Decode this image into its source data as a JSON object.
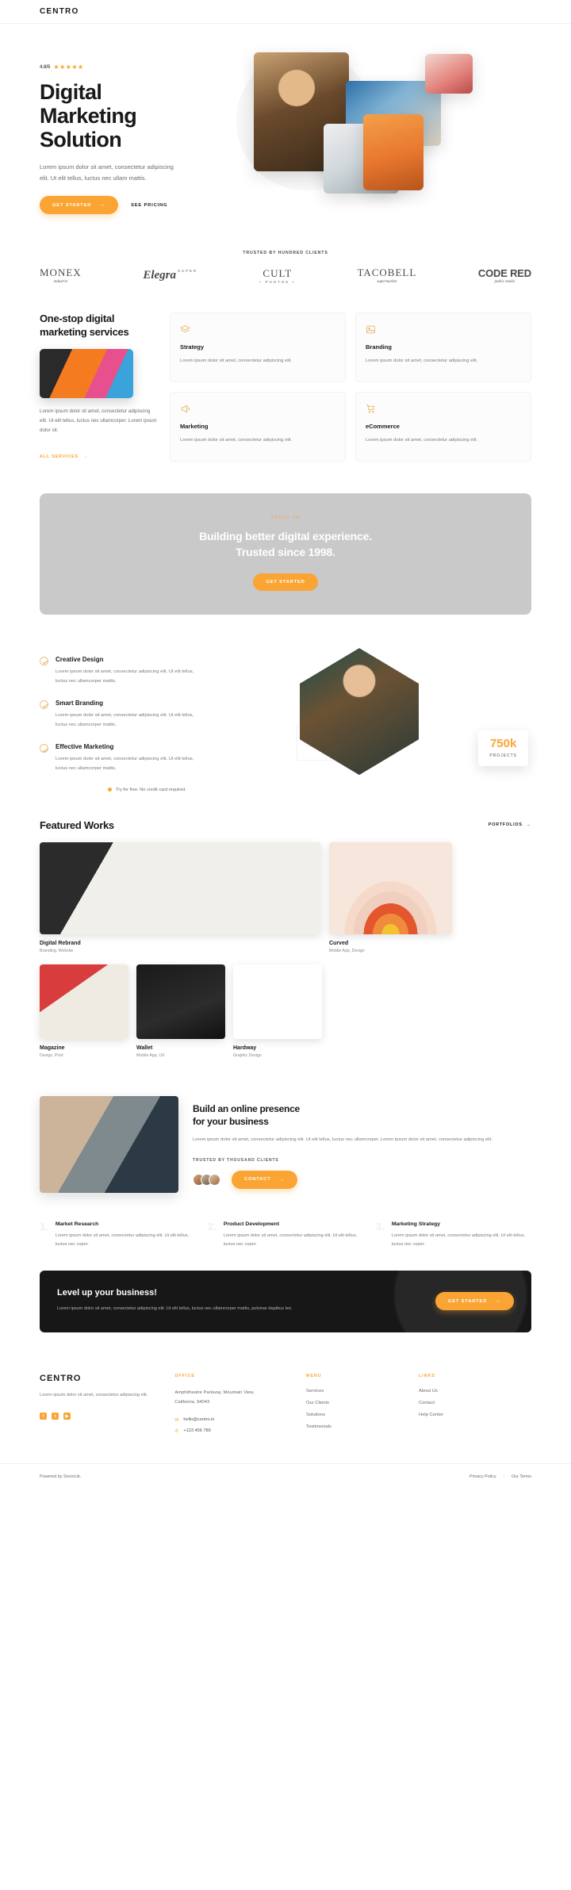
{
  "nav": {
    "brand": "CENTRO"
  },
  "hero": {
    "rating_value": "4.8/5",
    "stars": "★★★★★",
    "title_line1": "Digital",
    "title_line2": "Marketing",
    "title_line3": "Solution",
    "subtitle": "Lorem ipsum dolor sit amet, consectetur adipiscing elit. Ut elit tellus, luctus nec ullam mattis.",
    "cta_primary": "GET STARTED",
    "cta_arrow": "→",
    "cta_secondary": "SEE PRICING"
  },
  "clients": {
    "label": "TRUSTED BY HUNDRED CLIENTS",
    "logos": [
      {
        "name": "MONEX",
        "tag": "industrie"
      },
      {
        "name": "Elegra",
        "super": "SUPER",
        "tag": ""
      },
      {
        "name": "CULT",
        "tag": "+ PHOTOS +"
      },
      {
        "name": "TACOBELL",
        "tag": "supermarket"
      },
      {
        "name": "CODE RED",
        "tag": "public studio"
      }
    ]
  },
  "services": {
    "title": "One-stop digital marketing services",
    "description": "Lorem ipsum dolor sit amet, consectetur adipiscing elit. Ut elit tellus, luctus nec ullamcorper. Lorem ipsum dolor sit.",
    "link": "ALL SERVICES",
    "link_arrow": "→",
    "cards": [
      {
        "icon": "layers-icon",
        "title": "Strategy",
        "text": "Lorem ipsum dolor sit amet, consectetur adipiscing elit."
      },
      {
        "icon": "image-icon",
        "title": "Branding",
        "text": "Lorem ipsum dolor sit amet, consectetur adipiscing elit."
      },
      {
        "icon": "megaphone-icon",
        "title": "Marketing",
        "text": "Lorem ipsum dolor sit amet, consectetur adipiscing elit."
      },
      {
        "icon": "cart-icon",
        "title": "eCommerce",
        "text": "Lorem ipsum dolor sit amet, consectetur adipiscing elit."
      }
    ]
  },
  "banner": {
    "eyebrow": "ABOUT US",
    "line1": "Building better digital experience.",
    "line2": "Trusted since 1998.",
    "cta": "GET STARTED",
    "bg_color": "#c9c9c9"
  },
  "features": {
    "items": [
      {
        "title": "Creative Design",
        "text": "Lorem ipsum dolor sit amet, consectetur adipiscing elit. Ut elit tellus, luctus nec ullamcorper mattis."
      },
      {
        "title": "Smart Branding",
        "text": "Lorem ipsum dolor sit amet, consectetur adipiscing elit. Ut elit tellus, luctus nec ullamcorper mattis."
      },
      {
        "title": "Effective Marketing",
        "text": "Lorem ipsum dolor sit amet, consectetur adipiscing elit. Ut elit tellus, luctus nec ullamcorper mattis."
      }
    ],
    "note": "Try for free. No credit card required.",
    "stat_number": "750k",
    "stat_label": "PROJECTS"
  },
  "works": {
    "heading": "Featured Works",
    "link": "PORTFOLIOS",
    "link_arrow": "→",
    "items": [
      {
        "title": "Digital Rebrand",
        "category": "Branding, Website"
      },
      {
        "title": "Curved",
        "category": "Mobile App, Design"
      },
      {
        "title": "Magazine",
        "category": "Design, Print"
      },
      {
        "title": "Wallet",
        "category": "Mobile App, UX"
      },
      {
        "title": "Hardway",
        "category": "Graphic Design"
      }
    ]
  },
  "presence": {
    "title_line1": "Build an online presence",
    "title_line2": "for your business",
    "text": "Lorem ipsum dolor sit amet, consectetur adipiscing elit. Ut elit tellus, luctus nec ullamcorper. Lorem ipsum dolor sit amet, consectetur adipiscing elit.",
    "trusted_label": "TRUSTED BY THOUSAND CLIENTS",
    "cta": "CONTACT",
    "cta_arrow": "→"
  },
  "steps": [
    {
      "num": "1.",
      "title": "Market Research",
      "text": "Lorem ipsum dolor sit amet, consectetur adipiscing elit. Ut elit tellus, luctus nec coper."
    },
    {
      "num": "2.",
      "title": "Product Development",
      "text": "Lorem ipsum dolor sit amet, consectetur adipiscing elit. Ut elit tellus, luctus nec coper."
    },
    {
      "num": "3.",
      "title": "Marketing Strategy",
      "text": "Lorem ipsum dolor sit amet, consectetur adipiscing elit. Ut elit tellus, luctus nec coper."
    }
  ],
  "levelup": {
    "title": "Level up your business!",
    "text": "Lorem ipsum dolor sit amet, consectetur adipiscing elit. Ut elit tellus, luctus nec ullamcorper mattis, pulvinar dapibus leo.",
    "cta": "GET STARTED",
    "cta_arrow": "→"
  },
  "footer": {
    "brand": "CENTRO",
    "tagline": "Lorem ipsum dolor sit amet, consectetur adipiscing elit.",
    "socials": [
      {
        "name": "facebook-icon",
        "glyph": "f"
      },
      {
        "name": "twitter-icon",
        "glyph": "t"
      },
      {
        "name": "youtube-icon",
        "glyph": "▶"
      }
    ],
    "office": {
      "heading": "OFFICE",
      "address": "Amphitheatre Parkway, Mountain View, California, 94043",
      "email": "hello@centro.io",
      "phone": "+123 456 789"
    },
    "menu": {
      "heading": "MENU",
      "items": [
        "Services",
        "Our Clients",
        "Solutions",
        "Testimonials"
      ]
    },
    "links": {
      "heading": "LINKS",
      "items": [
        "About Us",
        "Contact",
        "Help Center"
      ]
    },
    "powered_by": "Powered by SocioLib.",
    "privacy": "Privacy Policy",
    "terms": "Our Terms"
  },
  "colors": {
    "accent": "#faa433",
    "dark": "#171717",
    "muted": "#7a7a7a"
  }
}
